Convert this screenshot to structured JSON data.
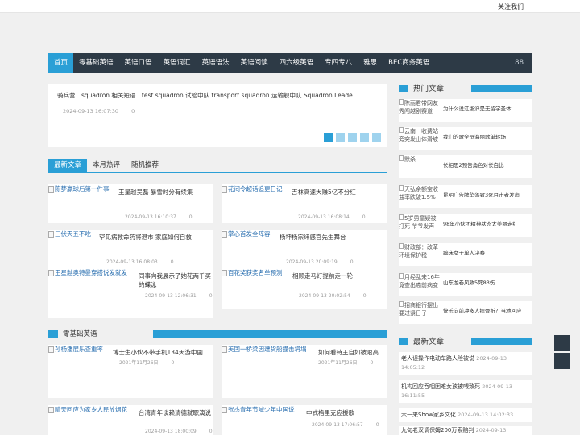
{
  "topbar": {
    "follow": "关注我们"
  },
  "nav": {
    "items": [
      "首页",
      "零基础英语",
      "英语口语",
      "英语词汇",
      "英语语法",
      "英语阅读",
      "四六级英语",
      "专四专八",
      "雅思",
      "BEC商务英语"
    ],
    "more": "88"
  },
  "slide": {
    "title": "骑兵营　squadron 相关短语　test squadron 试验中队 transport squadron 运输舰中队 Squadron Leade ...",
    "date": "2024-09-13 16:07:30",
    "count": "0"
  },
  "tabs": [
    "最新文章",
    "本月热评",
    "随机推荐"
  ],
  "articles": [
    {
      "thumb": "陈梦赢球后第一件事",
      "title": "王星越吴磊 暴雪时分有续集",
      "date": "2024-09-13 16:10:37",
      "count": "0"
    },
    {
      "thumb": "花间令超话追更日记",
      "title": "吉林高速大赚5亿不分红",
      "date": "2024-09-13 16:08:14",
      "count": "0"
    },
    {
      "thumb": "三伏天五不吃",
      "title": "罕见病救命药将退市 家庭如何自救",
      "date": "2024-09-13 16:08:03",
      "count": "0"
    },
    {
      "thumb": "掌心首发全阵容",
      "title": "杨坤杨宗纬感官先生舞台",
      "date": "2024-09-13 20:09:19",
      "count": "0"
    },
    {
      "thumb": "王星越奥特曼穿搭说发就发",
      "title": "同事向我展示了她花两千买的蝶泳",
      "date": "2024-09-13 12:06:31",
      "count": "0"
    },
    {
      "thumb": "百花奖获奖名单预测",
      "title": "相顾走马灯提前走一轮",
      "date": "2024-09-13 20:02:54",
      "count": "0"
    }
  ],
  "section": {
    "label": "零基础英语"
  },
  "section_articles": [
    {
      "thumb": "孙杨潘展乐查重率",
      "title": "博士生小伙不带手机134天游中国",
      "date": "2021年11月26日",
      "count": "0"
    },
    {
      "thumb": "美国一桥梁因遭货船撞击坍塌",
      "title": "如何看待王自如被限高",
      "date": "2021年11月26日",
      "count": "0"
    },
    {
      "thumb": "晴天回应为家乡人民放烟花",
      "title": "台湾青年谈赖清德就职演说",
      "date": "2024-09-13 18:00:09",
      "count": "0"
    },
    {
      "thumb": "张杰青年节喊少年中国说",
      "title": "中式格里克应援歌",
      "date": "2024-09-13 17:06:57",
      "count": "0"
    }
  ],
  "sidebar": {
    "hot_label": "热门文章",
    "hot": [
      {
        "img": "陈丽君带网友秀闯越剧赛道",
        "title": "为什么说江浙沪是无留学圣体"
      },
      {
        "img": "云南一收费站旁突发山体滑坡",
        "title": "我们的歌全员海丽歌单转场"
      },
      {
        "img": "默杀",
        "title": "长相思2预告角色对长白比"
      },
      {
        "img": "天弘余额宝收益率跌破1.5%",
        "title": "昆明广告牌坠落致3死目击者发声"
      },
      {
        "img": "5岁男童疑被打死 爷爷发声",
        "title": "98年小伙团精神状态太美丽走红"
      },
      {
        "img": "财政部：改革环境保护税",
        "title": "蹦床女子单人决赛"
      },
      {
        "img": "月经乱来16年竟查出癌前病变",
        "title": "山东龙卷风致5死83伤"
      },
      {
        "img": "招商银行摆出要过紧日子",
        "title": "快乐向前冲多人摔骨折？当地回应"
      }
    ],
    "new_label": "最新文章",
    "new": [
      {
        "title": "老人误操作电动车路人险被说",
        "date": "2024-09-13 14:05:12"
      },
      {
        "title": "机构回应吞咽困难女孩被喂致死",
        "date": "2024-09-13 16:11:55"
      },
      {
        "title": "六一来Show家乡文化",
        "date": "2024-09-13 14:02:33"
      },
      {
        "title": "九旬老汉调保姆200万索赔判",
        "date": "2024-09-13"
      }
    ]
  }
}
